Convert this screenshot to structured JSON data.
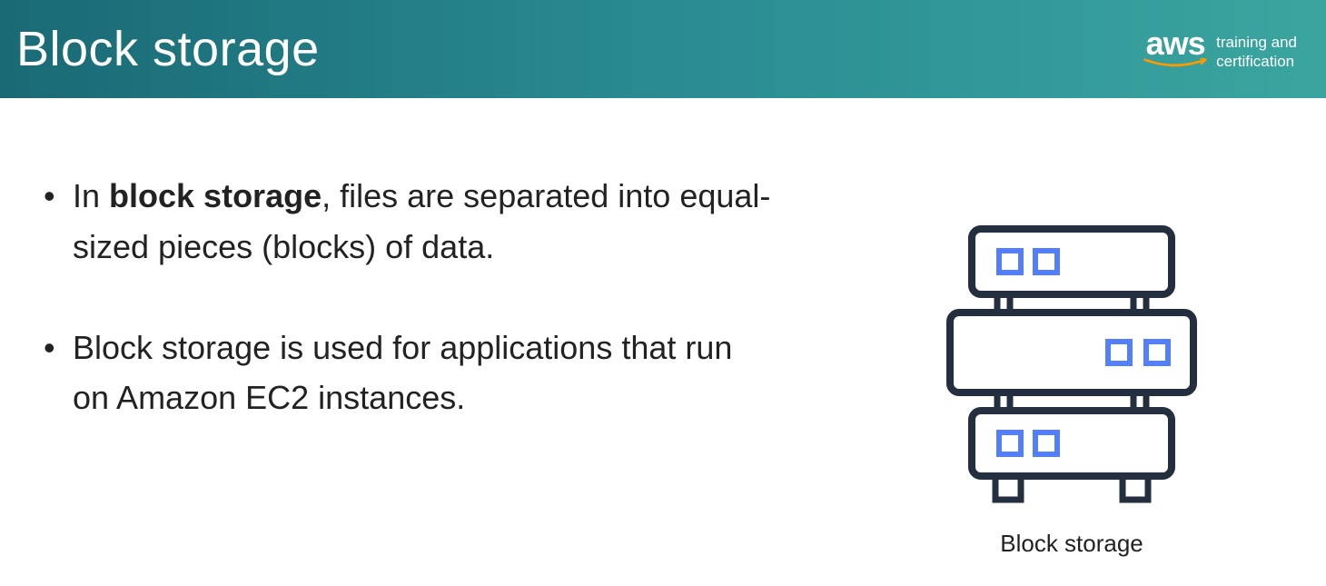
{
  "header": {
    "title": "Block storage",
    "brand_logo_text": "aws",
    "brand_subtitle_line1": "training and",
    "brand_subtitle_line2": "certification"
  },
  "bullets": [
    {
      "prefix": "In ",
      "bold": "block storage",
      "suffix": ", files are separated into equal-sized pieces (blocks) of data."
    },
    {
      "prefix": "",
      "bold": "",
      "suffix": "Block storage is used for applications that run on Amazon EC2 instances."
    }
  ],
  "illustration": {
    "caption": "Block storage"
  },
  "colors": {
    "header_gradient_start": "#196a75",
    "header_gradient_end": "#3aa59f",
    "aws_smile": "#ff9900",
    "icon_stroke": "#232f3e",
    "icon_accent": "#527fff"
  }
}
